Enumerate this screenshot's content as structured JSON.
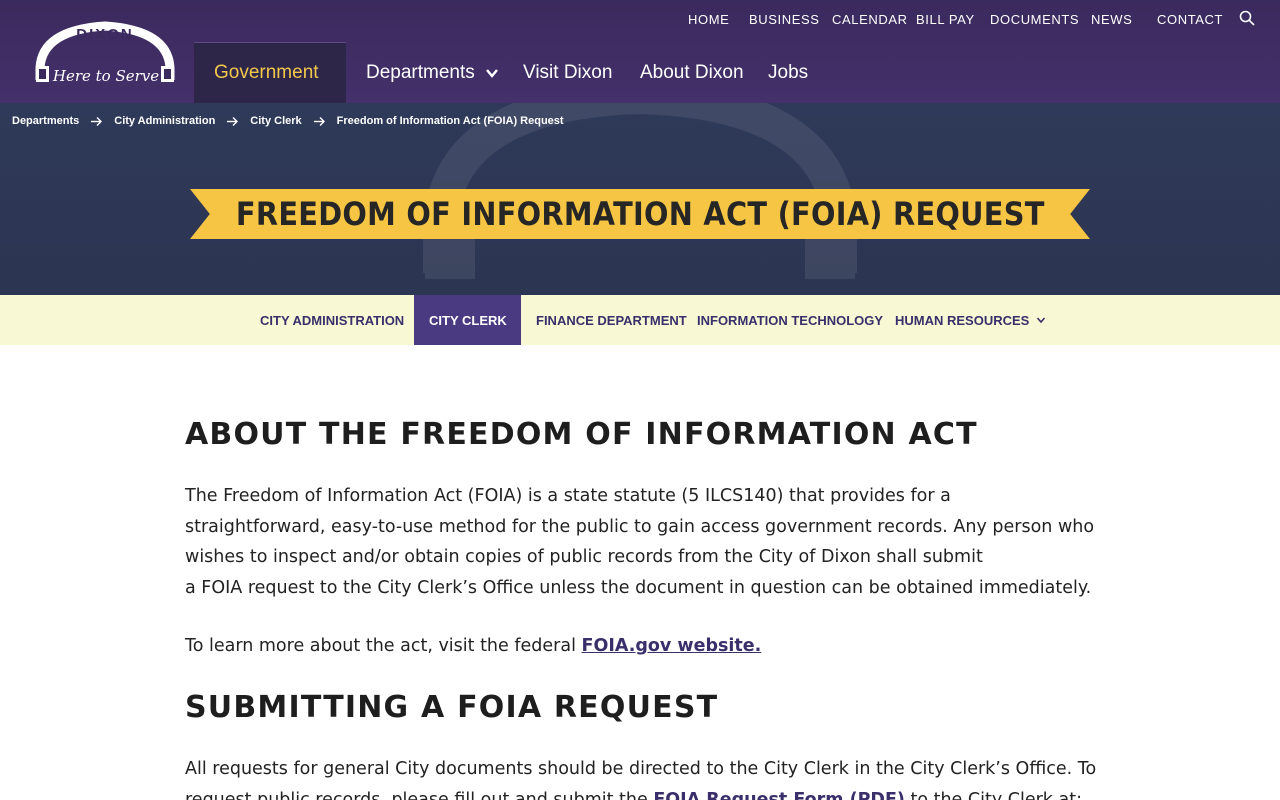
{
  "brand": {
    "logo_word": "DIXON",
    "logo_tagline": "Here to Serve",
    "header_color": "#3b2a5e",
    "accent_color": "#f6c544",
    "subnav_bg": "#f8f8d4",
    "link_color": "#3a2f6b"
  },
  "utility_nav": {
    "items": [
      "HOME",
      "BUSINESS",
      "CALENDAR",
      "BILL PAY",
      "DOCUMENTS",
      "NEWS",
      "CONTACT"
    ],
    "search_icon": "search-icon"
  },
  "main_nav": {
    "items": [
      {
        "label": "Government",
        "has_dropdown": true,
        "active": true
      },
      {
        "label": "Departments",
        "has_dropdown": true,
        "active": false
      },
      {
        "label": "Visit Dixon",
        "has_dropdown": false,
        "active": false
      },
      {
        "label": "About Dixon",
        "has_dropdown": false,
        "active": false
      },
      {
        "label": "Jobs",
        "has_dropdown": false,
        "active": false
      }
    ]
  },
  "breadcrumb": {
    "items": [
      "Departments",
      "City Administration",
      "City Clerk",
      "Freedom of Information Act (FOIA) Request"
    ]
  },
  "hero": {
    "title": "FREEDOM OF INFORMATION ACT (FOIA) REQUEST"
  },
  "sub_nav": {
    "items": [
      {
        "label": "CITY ADMINISTRATION",
        "has_dropdown": false,
        "active": false
      },
      {
        "label": "CITY CLERK",
        "has_dropdown": true,
        "active": true
      },
      {
        "label": "FINANCE DEPARTMENT",
        "has_dropdown": false,
        "active": false
      },
      {
        "label": "INFORMATION TECHNOLOGY",
        "has_dropdown": false,
        "active": false
      },
      {
        "label": "HUMAN RESOURCES",
        "has_dropdown": true,
        "active": false
      }
    ]
  },
  "content": {
    "section1_heading": "ABOUT THE FREEDOM OF INFORMATION ACT",
    "section1_para_lines": [
      "The Freedom of Information Act (FOIA) is a state statute (5 ILCS140) that provides for a",
      "straightforward, easy-to-use method for the public to gain access government records. Any person who",
      "wishes to inspect and/or obtain copies of public records from the City of Dixon shall submit",
      "a FOIA request to the City Clerk’s Office unless the document in question can be obtained immediately."
    ],
    "section1_para2_text": "To learn more about the act, visit the federal ",
    "section1_para2_link": "FOIA.gov website.",
    "section2_heading": "SUBMITTING A FOIA REQUEST",
    "section2_para_line1": "All requests for general City documents should be directed to the City Clerk in the City Clerk’s Office. To",
    "section2_para_line2_before": "request public records, please fill out and submit the ",
    "section2_para_line2_link": "FOIA Request Form (PDF)",
    "section2_para_line2_after": " to the City Clerk at:"
  }
}
